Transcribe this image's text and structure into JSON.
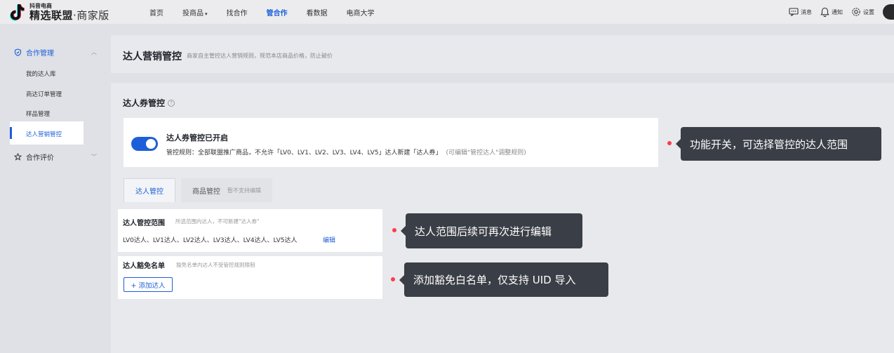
{
  "brand": {
    "top": "抖音电商",
    "main": "精选联盟",
    "sub": "·商家版"
  },
  "nav": {
    "items": [
      {
        "label": "首页"
      },
      {
        "label": "投商品",
        "caret": "▾"
      },
      {
        "label": "找合作"
      },
      {
        "label": "管合作"
      },
      {
        "label": "看数据"
      },
      {
        "label": "电商大学"
      }
    ],
    "active": "管合作"
  },
  "topright": {
    "messages": "消息",
    "notifications": "通知",
    "settings": "设置"
  },
  "sidebar": {
    "group1": {
      "label": "合作管理",
      "chev": "︿"
    },
    "items": [
      {
        "label": "我的达人库"
      },
      {
        "label": "商达订单管理"
      },
      {
        "label": "样品管理"
      },
      {
        "label": "达人营销管控"
      }
    ],
    "group2": {
      "label": "合作评价",
      "chev": "﹀"
    }
  },
  "header": {
    "title": "达人营销管控",
    "subtitle": "商家自主管控达人营销规则，规范本店商品价格，防止破价"
  },
  "coupon": {
    "title": "达人券管控",
    "info": "?",
    "switch_on": true,
    "toggle_title": "达人券管控已开启",
    "rule": "管控规则：全部联盟推广商品，不允许「LV0、LV1、LV2、LV3、LV4、LV5」达人新建「达人券」",
    "rule_hint": "(可编辑\"管控达人\"调整规则)"
  },
  "tabs": [
    {
      "label": "达人管控"
    },
    {
      "label": "商品管控",
      "note": "暂不支持编辑"
    }
  ],
  "scope": {
    "title": "达人管控范围",
    "subtitle": "所选范围内达人，不可新建\"达人券\"",
    "levels": "LV0达人、LV1达人、LV2达人、LV3达人、LV4达人、LV5达人",
    "edit": "编辑"
  },
  "exempt": {
    "title": "达人豁免名单",
    "subtitle": "豁免名单内达人不受管控规则限制",
    "add_button": "+ 添加达人"
  },
  "callouts": [
    {
      "text": "功能开关，可选择管控的达人范围"
    },
    {
      "text": "达人范围后续可再次进行编辑"
    },
    {
      "text": "添加豁免白名单，仅支持 UID 导入"
    }
  ],
  "colors": {
    "accent": "#1d5fd9",
    "callout_bg": "#3a3e46",
    "dot": "#ff3b4a"
  }
}
